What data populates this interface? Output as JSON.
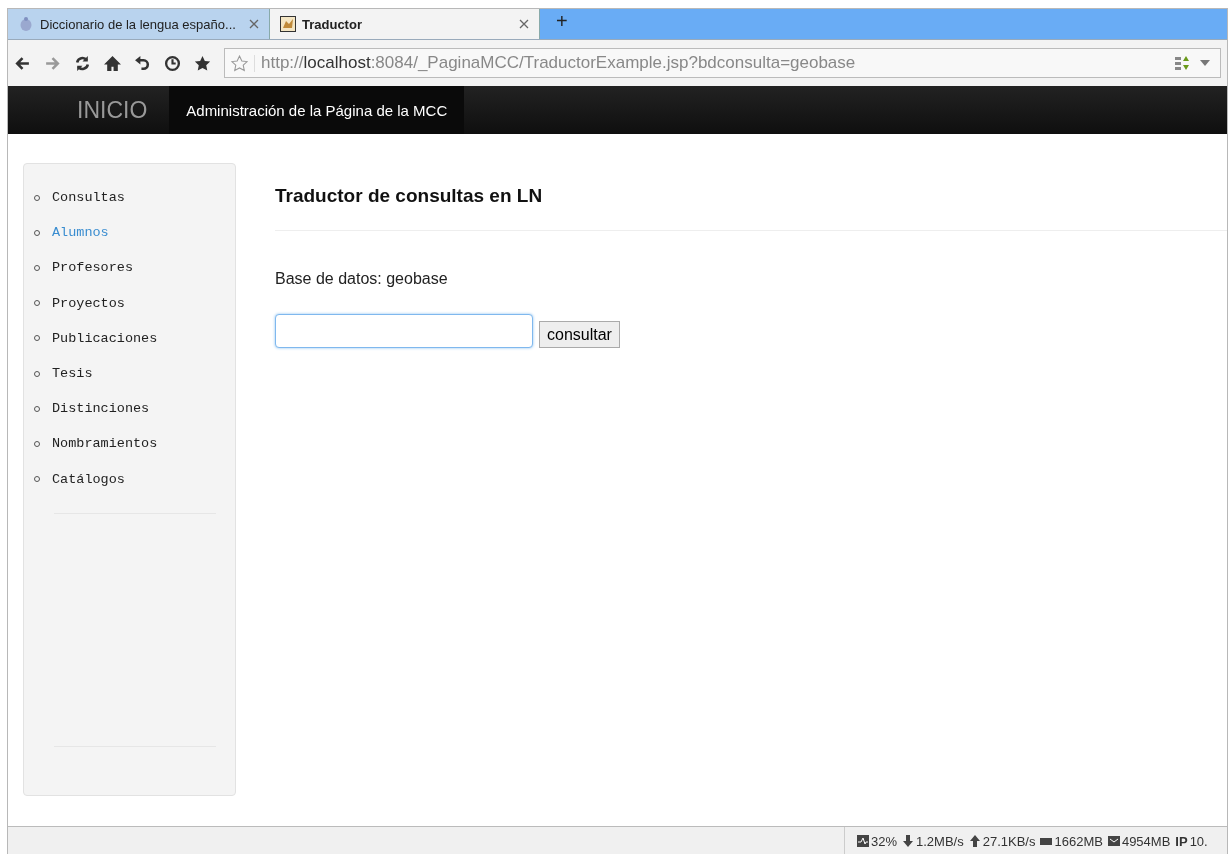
{
  "tabs": [
    {
      "title": "Diccionario de la lengua españo...",
      "selected": false
    },
    {
      "title": "Traductor",
      "selected": true
    }
  ],
  "new_tab": "+",
  "address_bar": {
    "scheme": "http://",
    "host": "localhost",
    "path": ":8084/_PaginaMCC/TraductorExample.jsp?bdconsulta=geobase"
  },
  "navbar": {
    "brand": "INICIO",
    "items": [
      {
        "label": "Administración de la Página de la MCC",
        "selected": true
      }
    ]
  },
  "sidebar": {
    "items": [
      {
        "label": "Consultas",
        "selected": false
      },
      {
        "label": "Alumnos",
        "selected": true
      },
      {
        "label": "Profesores",
        "selected": false
      },
      {
        "label": "Proyectos",
        "selected": false
      },
      {
        "label": "Publicaciones",
        "selected": false
      },
      {
        "label": "Tesis",
        "selected": false
      },
      {
        "label": "Distinciones",
        "selected": false
      },
      {
        "label": "Nombramientos",
        "selected": false
      },
      {
        "label": "Catálogos",
        "selected": false
      }
    ]
  },
  "main": {
    "heading": "Traductor de consultas en LN",
    "database_label": "Base de datos: geobase",
    "query_field": {
      "focused": true
    },
    "submit_button": "consultar"
  },
  "status_bar": [
    {
      "kind": "cpu",
      "text": "32%"
    },
    {
      "kind": "down",
      "text": "1.2MB/s"
    },
    {
      "kind": "up",
      "text": "27.1KB/s"
    },
    {
      "kind": "mem",
      "text": "1662MB"
    },
    {
      "kind": "disk",
      "text": "4954MB"
    },
    {
      "kind": "ip",
      "label": "IP",
      "text": "10."
    }
  ]
}
